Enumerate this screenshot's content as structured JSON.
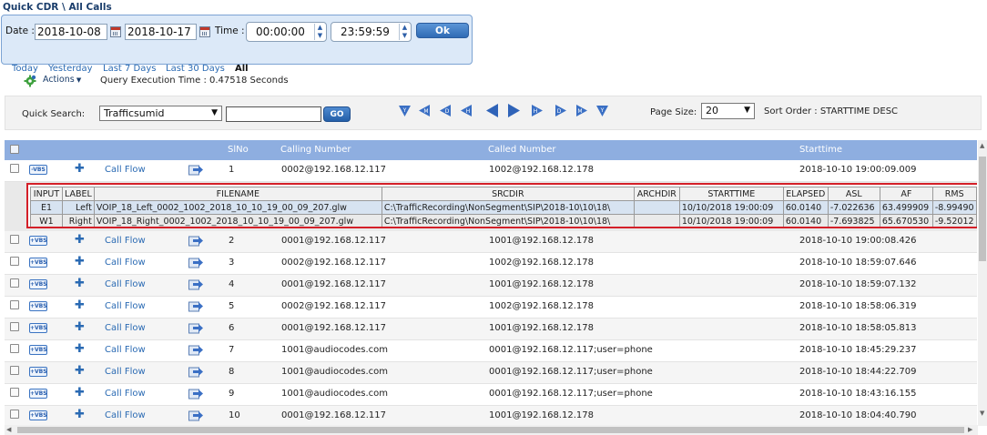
{
  "breadcrumb": "Quick CDR \\ All Calls",
  "filter": {
    "date_label": "Date :",
    "from_date": "2018-10-08",
    "to_date": "2018-10-17",
    "time_label": "Time :",
    "from_time": "00:00:00",
    "to_time": "23:59:59",
    "ok_label": "Ok",
    "quick_links": [
      "Today",
      "Yesterday",
      "Last 7 Days",
      "Last 30 Days",
      "All"
    ],
    "active_link": "All"
  },
  "actions": {
    "label": "Actions",
    "query_time": "Query Execution Time : 0.47518 Seconds"
  },
  "search": {
    "label": "Quick Search:",
    "field": "Trafficsumid",
    "value": "",
    "go_label": "GO",
    "nav_letters": [
      "Y",
      "M",
      "D",
      "H",
      "",
      "",
      "H",
      "D",
      "M",
      "Y"
    ],
    "page_size_label": "Page Size:",
    "page_size": "20",
    "sort_order": "Sort Order : STARTTIME DESC"
  },
  "grid": {
    "headers": {
      "slno": "SlNo",
      "calling": "Calling Number",
      "called": "Called Number",
      "starttime": "Starttime"
    },
    "vbs_label_first": "-VBS",
    "vbs_label": "+VBS",
    "call_flow_label": "Call Flow",
    "rows": [
      {
        "slno": "1",
        "calling": "0002@192.168.12.117",
        "called": "1002@192.168.12.178",
        "start": "2018-10-10 19:00:09.009"
      },
      {
        "slno": "2",
        "calling": "0001@192.168.12.117",
        "called": "1001@192.168.12.178",
        "start": "2018-10-10 19:00:08.426"
      },
      {
        "slno": "3",
        "calling": "0002@192.168.12.117",
        "called": "1002@192.168.12.178",
        "start": "2018-10-10 18:59:07.646"
      },
      {
        "slno": "4",
        "calling": "0001@192.168.12.117",
        "called": "1001@192.168.12.178",
        "start": "2018-10-10 18:59:07.132"
      },
      {
        "slno": "5",
        "calling": "0002@192.168.12.117",
        "called": "1002@192.168.12.178",
        "start": "2018-10-10 18:58:06.319"
      },
      {
        "slno": "6",
        "calling": "0001@192.168.12.117",
        "called": "1001@192.168.12.178",
        "start": "2018-10-10 18:58:05.813"
      },
      {
        "slno": "7",
        "calling": "1001@audiocodes.com",
        "called": "0001@192.168.12.117;user=phone",
        "start": "2018-10-10 18:45:29.237"
      },
      {
        "slno": "8",
        "calling": "1001@audiocodes.com",
        "called": "0001@192.168.12.117;user=phone",
        "start": "2018-10-10 18:44:22.709"
      },
      {
        "slno": "9",
        "calling": "1001@audiocodes.com",
        "called": "0001@192.168.12.117;user=phone",
        "start": "2018-10-10 18:43:16.155"
      },
      {
        "slno": "10",
        "calling": "0001@192.168.12.117",
        "called": "1001@192.168.12.178",
        "start": "2018-10-10 18:04:40.790"
      }
    ]
  },
  "detail": {
    "headers": [
      "INPUT",
      "LABEL",
      "FILENAME",
      "SRCDIR",
      "ARCHDIR",
      "STARTTIME",
      "ELAPSED",
      "ASL",
      "AF",
      "RMS"
    ],
    "rows": [
      [
        "E1",
        "Left",
        "VOIP_18_Left_0002_1002_2018_10_10_19_00_09_207.glw",
        "C:\\TrafficRecording\\NonSegment\\SIP\\2018-10\\10\\18\\",
        "",
        "10/10/2018 19:00:09",
        "60.0140",
        "-7.022636",
        "63.499909",
        "-8.99490"
      ],
      [
        "W1",
        "Right",
        "VOIP_18_Right_0002_1002_2018_10_10_19_00_09_207.glw",
        "C:\\TrafficRecording\\NonSegment\\SIP\\2018-10\\10\\18\\",
        "",
        "10/10/2018 19:00:09",
        "60.0140",
        "-7.693825",
        "65.670530",
        "-9.52012"
      ]
    ]
  }
}
